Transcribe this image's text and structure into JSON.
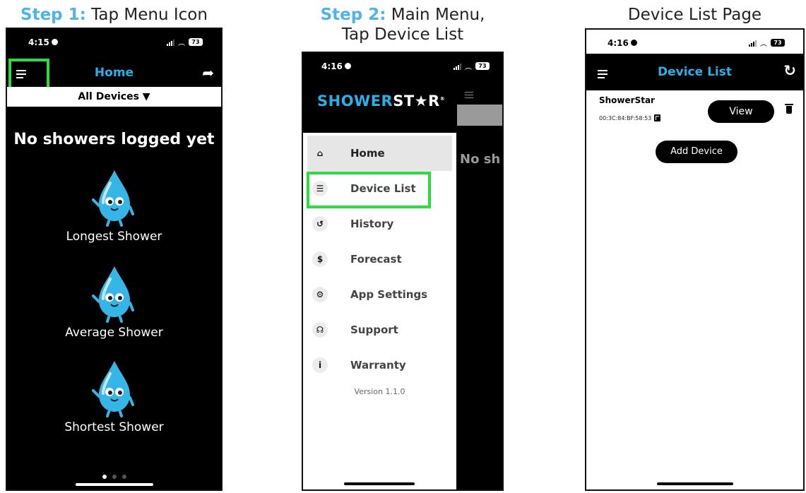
{
  "captions": {
    "step1": {
      "prefix": "Step 1:",
      "text": " Tap Menu Icon"
    },
    "step2": {
      "prefix": "Step 2:",
      "text": " Main Menu,",
      "line2": "Tap Device List"
    },
    "step3": {
      "text": "Device List Page"
    }
  },
  "phone1": {
    "time": "4:15",
    "battery": "73",
    "title": "Home",
    "filter_label": "All Devices",
    "empty_message": "No showers logged yet",
    "stats": [
      {
        "label": "Longest Shower"
      },
      {
        "label": "Average Shower"
      },
      {
        "label": "Shortest Shower"
      }
    ],
    "icons": {
      "menu": "hamburger-icon",
      "share": "share-arrow-icon",
      "filter": "filter-funnel-icon"
    },
    "highlight_color": "#2bdc3f"
  },
  "phone2": {
    "time": "4:16",
    "battery": "73",
    "logo_part1": "SHOWER",
    "logo_part2": "ST★R",
    "logo_mark": "®",
    "background_text": "No sh",
    "menu": [
      {
        "label": "Home",
        "icon": "⌂"
      },
      {
        "label": "Device List",
        "icon": "☰"
      },
      {
        "label": "History",
        "icon": "↺"
      },
      {
        "label": "Forecast",
        "icon": "$"
      },
      {
        "label": "App Settings",
        "icon": "⚙"
      },
      {
        "label": "Support",
        "icon": "☊"
      },
      {
        "label": "Warranty",
        "icon": "i"
      }
    ],
    "version": "Version 1.1.0"
  },
  "phone3": {
    "time": "4:16",
    "battery": "73",
    "title": "Device List",
    "device": {
      "name": "ShowerStar",
      "mac": "00:3C:84:BF:58:53"
    },
    "view_label": "View",
    "add_label": "Add Device",
    "icons": {
      "menu": "hamburger-icon",
      "refresh": "refresh-icon",
      "copy": "copy-icon",
      "delete": "trash-icon"
    }
  },
  "colors": {
    "accent": "#2ab0e8",
    "step_label": "#4fb3e8",
    "highlight": "#2bdc3f"
  }
}
